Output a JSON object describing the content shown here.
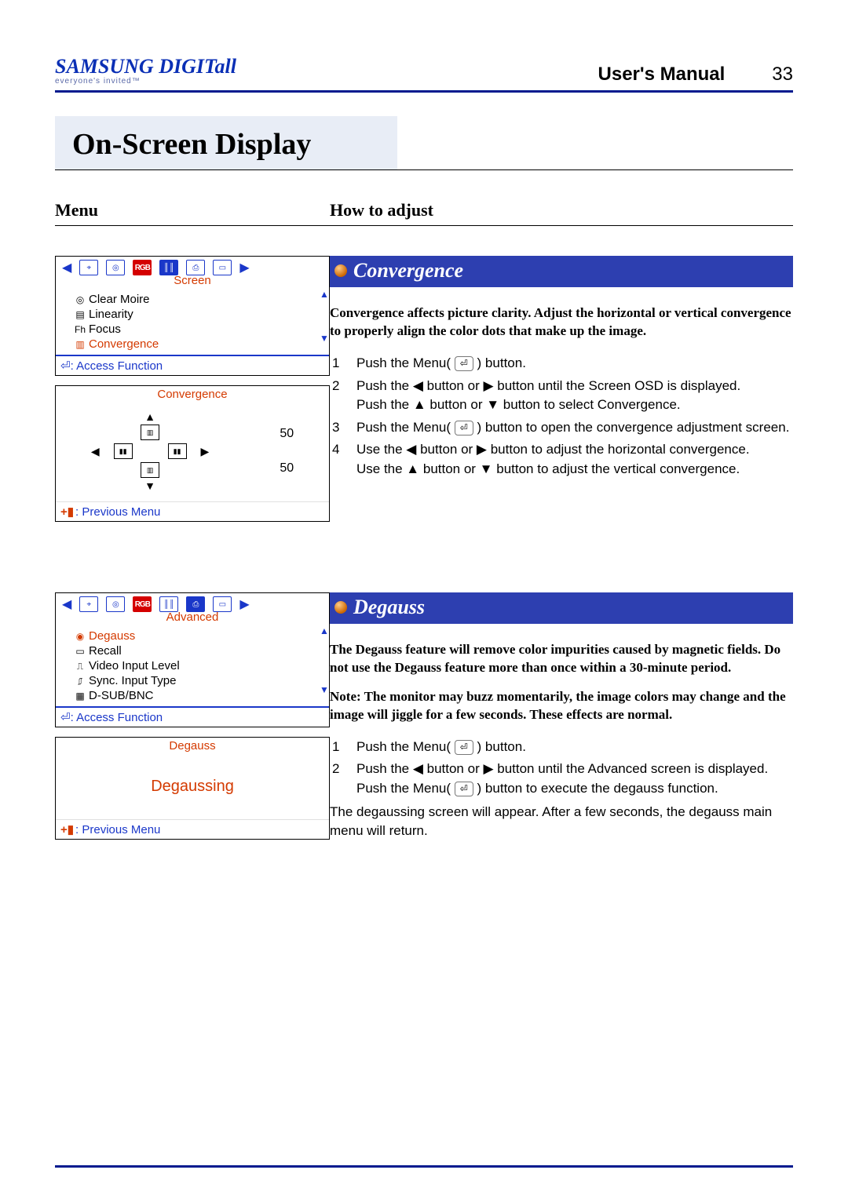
{
  "header": {
    "brand": "SAMSUNG DIGITall",
    "tagline": "everyone's invited™",
    "manual_label": "User's Manual",
    "page_number": "33"
  },
  "page_title": "On-Screen Display",
  "subhead": {
    "left": "Menu",
    "right": "How to adjust"
  },
  "convergence": {
    "osd_tab": "Screen",
    "menu_items": [
      {
        "icon": "moire-icon",
        "label": "Clear Moire",
        "selected": false
      },
      {
        "icon": "linearity-icon",
        "label": "Linearity",
        "selected": false
      },
      {
        "icon": "focus-icon",
        "label": "Focus",
        "selected": false
      },
      {
        "icon": "convergence-icon",
        "label": "Convergence",
        "selected": true
      }
    ],
    "access_label": ": Access Function",
    "detail_title": "Convergence",
    "value_h": "50",
    "value_v": "50",
    "prev_label": ": Previous Menu",
    "section_title": "Convergence",
    "intro": "Convergence affects picture clarity. Adjust the horizontal or vertical convergence to properly align the color dots that make up the image.",
    "steps": {
      "s1": "Push the Menu(",
      "s1b": ") button.",
      "s2": "Push the ◀ button or ▶ button until the Screen OSD is displayed.",
      "s2b": "Push the ▲ button or ▼ button to select Convergence.",
      "s3": "Push the Menu(",
      "s3b": ") button to open the convergence adjustment screen.",
      "s4": "Use the ◀ button or ▶ button to adjust the horizontal convergence.",
      "s4b": "Use the ▲ button or ▼ button to adjust the vertical convergence."
    }
  },
  "degauss": {
    "osd_tab": "Advanced",
    "menu_items": [
      {
        "icon": "degauss-icon",
        "label": "Degauss",
        "selected": true
      },
      {
        "icon": "recall-icon",
        "label": "Recall",
        "selected": false
      },
      {
        "icon": "vinput-icon",
        "label": "Video Input Level",
        "selected": false
      },
      {
        "icon": "sync-icon",
        "label": "Sync. Input Type",
        "selected": false
      },
      {
        "icon": "dsub-icon",
        "label": "D-SUB/BNC",
        "selected": false
      }
    ],
    "access_label": ": Access Function",
    "detail_title": "Degauss",
    "detail_body": "Degaussing",
    "prev_label": ": Previous Menu",
    "section_title": "Degauss",
    "intro": "The Degauss feature will remove color impurities caused by magnetic fields. Do not use the Degauss feature more than once within a 30-minute period.",
    "note": "Note: The monitor may buzz momentarily, the image colors may change and the image will jiggle for a few seconds. These effects are normal.",
    "steps": {
      "s1": "Push the Menu(",
      "s1b": ") button.",
      "s2": "Push the ◀ button or ▶ button until the Advanced screen is displayed.",
      "s2b": "Push the Menu(",
      "s2c": ") button to execute the degauss function.",
      "tail": "The degaussing screen will appear. After a few seconds, the degauss main menu will return."
    }
  }
}
